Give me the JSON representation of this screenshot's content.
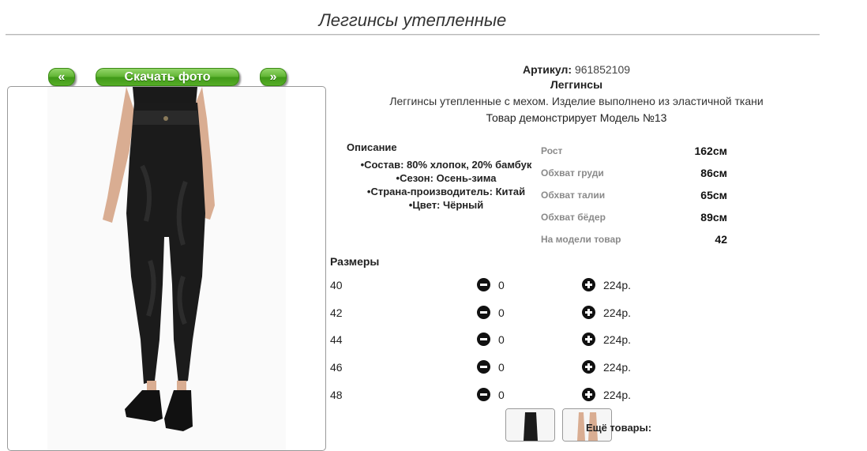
{
  "page": {
    "title": "Леггинсы утепленные"
  },
  "nav": {
    "prev_label": "«",
    "download_label": "Скачать фото",
    "next_label": "»"
  },
  "product": {
    "article_label": "Артикул:",
    "article_value": "961852109",
    "name": "Леггинсы",
    "description": "Леггинсы утепленные с мехом. Изделие выполнено из эластичной ткани",
    "model_text": "Товар демонстрирует Модель №13"
  },
  "details": {
    "heading": "Описание",
    "items": [
      "Состав: 80% хлопок, 20% бамбук",
      "Сезон: Осень-зима",
      "Страна-производитель: Китай",
      "Цвет: Чёрный"
    ]
  },
  "measurements": [
    {
      "label": "Рост",
      "value": "162см"
    },
    {
      "label": "Обхват груди",
      "value": "86см"
    },
    {
      "label": "Обхват талии",
      "value": "65см"
    },
    {
      "label": "Обхват бёдер",
      "value": "89см"
    },
    {
      "label": "На модели товар",
      "value": "42"
    }
  ],
  "sizes": {
    "heading": "Размеры",
    "rows": [
      {
        "size": "40",
        "qty": "0",
        "price": "224р."
      },
      {
        "size": "42",
        "qty": "0",
        "price": "224р."
      },
      {
        "size": "44",
        "qty": "0",
        "price": "224р."
      },
      {
        "size": "46",
        "qty": "0",
        "price": "224р."
      },
      {
        "size": "48",
        "qty": "0",
        "price": "224р."
      }
    ]
  },
  "more": {
    "label": "Ещё товары:"
  },
  "colors": {
    "button_green": "#56ad26",
    "text": "#222222",
    "label_gray": "#8a8a8a"
  }
}
